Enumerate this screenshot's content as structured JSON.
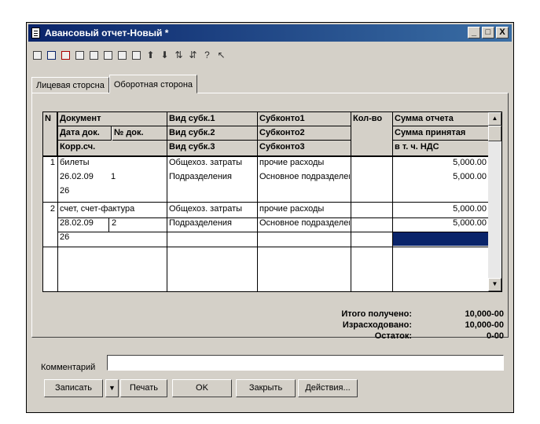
{
  "window": {
    "title": "Авансовый отчет-Новый *",
    "controls": {
      "minimize": "_",
      "maximize": "□",
      "close": "X"
    }
  },
  "tabs": [
    "Лицевая сторсна",
    "Оборотная сторона"
  ],
  "grid": {
    "headers": {
      "col_n": "N",
      "doc1": "Документ",
      "doc2a": "Дата док.",
      "doc2b": "№ док.",
      "doc3": "Корр.сч.",
      "vid1": "Вид субк.1",
      "vid2": "Вид субк.2",
      "vid3": "Вид субк.3",
      "sub1": "Субконто1",
      "sub2": "Субконто2",
      "sub3": "Субконто3",
      "qty": "Кол-во",
      "sum1": "Сумма отчета",
      "sum2": "Сумма принятая",
      "sum3": "в т. ч. НДС"
    },
    "rows": [
      {
        "n": "1",
        "doc": "билеты",
        "date": "26.02.09",
        "docnum": "1",
        "corr": "26",
        "vid1": "Общехоз. затраты",
        "vid2": "Подразделения",
        "sub1": "прочие расходы",
        "sub2": "Основное подразделен",
        "sum_report": "5,000.00",
        "sum_accepted": "5,000.00"
      },
      {
        "n": "2",
        "doc": "счет, счет-фактура",
        "date": "28.02.09",
        "docnum": "2",
        "corr": "26",
        "vid1": "Общехоз. затраты",
        "vid2": "Подразделения",
        "sub1": "прочие расходы",
        "sub2": "Основное подразделен",
        "sum_report": "5,000.00",
        "sum_accepted": "5,000.00"
      }
    ]
  },
  "totals": {
    "received_label": "Итого получено:",
    "received_value": "10,000-00",
    "spent_label": "Израсходовано:",
    "spent_value": "10,000-00",
    "balance_label": "Остаток:",
    "balance_value": "0-00"
  },
  "comment": {
    "label": "Комментарий",
    "value": ""
  },
  "buttons": {
    "record": "Записать",
    "print_arrow": "▼",
    "print": "Печать",
    "ok": "OK",
    "close": "Закрыть",
    "actions": "Действия..."
  },
  "colors": {
    "title_bar": "#0a246a",
    "window_bg": "#d4d0c8",
    "selection": "#0a246a"
  }
}
